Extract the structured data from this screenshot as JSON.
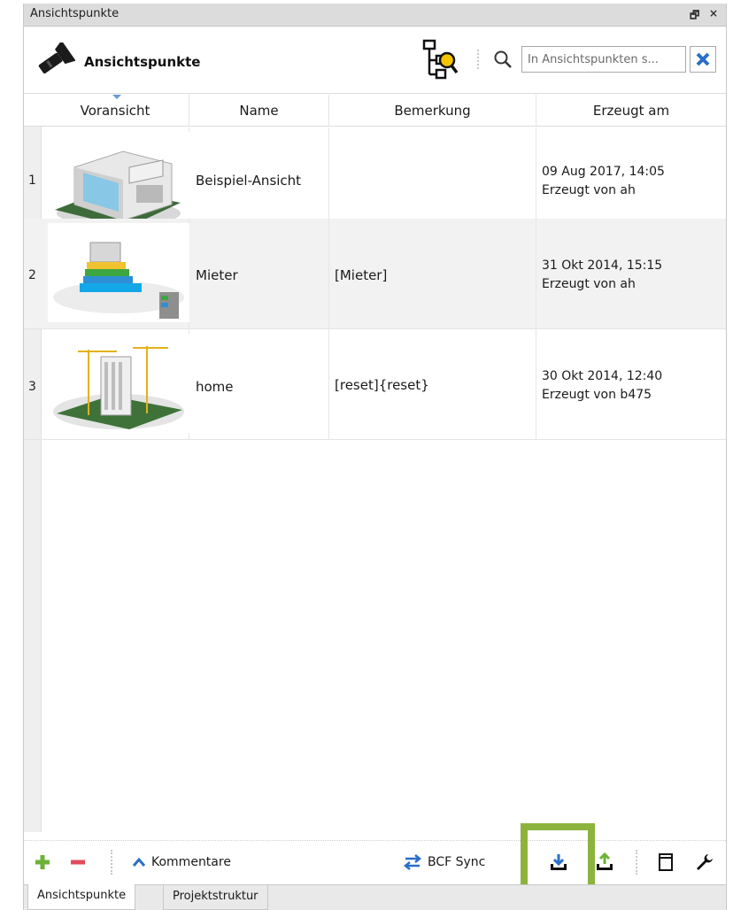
{
  "window": {
    "title": "Ansichtspunkte",
    "float_glyph": "🗗",
    "close_glyph": "×"
  },
  "header": {
    "title": "Ansichtspunkte",
    "search_placeholder": "In Ansichtspunkten s..."
  },
  "columns": {
    "preview": "Voransicht",
    "name": "Name",
    "remark": "Bemerkung",
    "created": "Erzeugt am"
  },
  "rows": [
    {
      "num": "1",
      "name": "Beispiel-Ansicht",
      "remark": "",
      "date": "09 Aug 2017, 14:05",
      "author": "Erzeugt von ah"
    },
    {
      "num": "2",
      "name": "Mieter",
      "remark": "[Mieter]",
      "date": "31 Okt 2014, 15:15",
      "author": "Erzeugt von ah"
    },
    {
      "num": "3",
      "name": "home",
      "remark": "[reset]{reset}",
      "date": "30 Okt 2014, 12:40",
      "author": "Erzeugt von b475"
    }
  ],
  "toolbar": {
    "comments_label": "Kommentare",
    "bcf_label": "BCF Sync"
  },
  "tabs": [
    "Ansichtspunkte",
    "Projektstruktur"
  ],
  "colors": {
    "accent_green": "#6bb237",
    "remove_red": "#e04b5a",
    "icon_blue": "#2a6fc9",
    "highlight": "#8cb43c",
    "tree_yellow": "#f5c400"
  },
  "icons": [
    "flashlight-icon",
    "tree-search-icon",
    "search-icon",
    "clear-icon",
    "add-icon",
    "remove-icon",
    "chevron-up-icon",
    "sync-icon",
    "import-icon",
    "export-icon",
    "page-icon",
    "wrench-icon"
  ]
}
